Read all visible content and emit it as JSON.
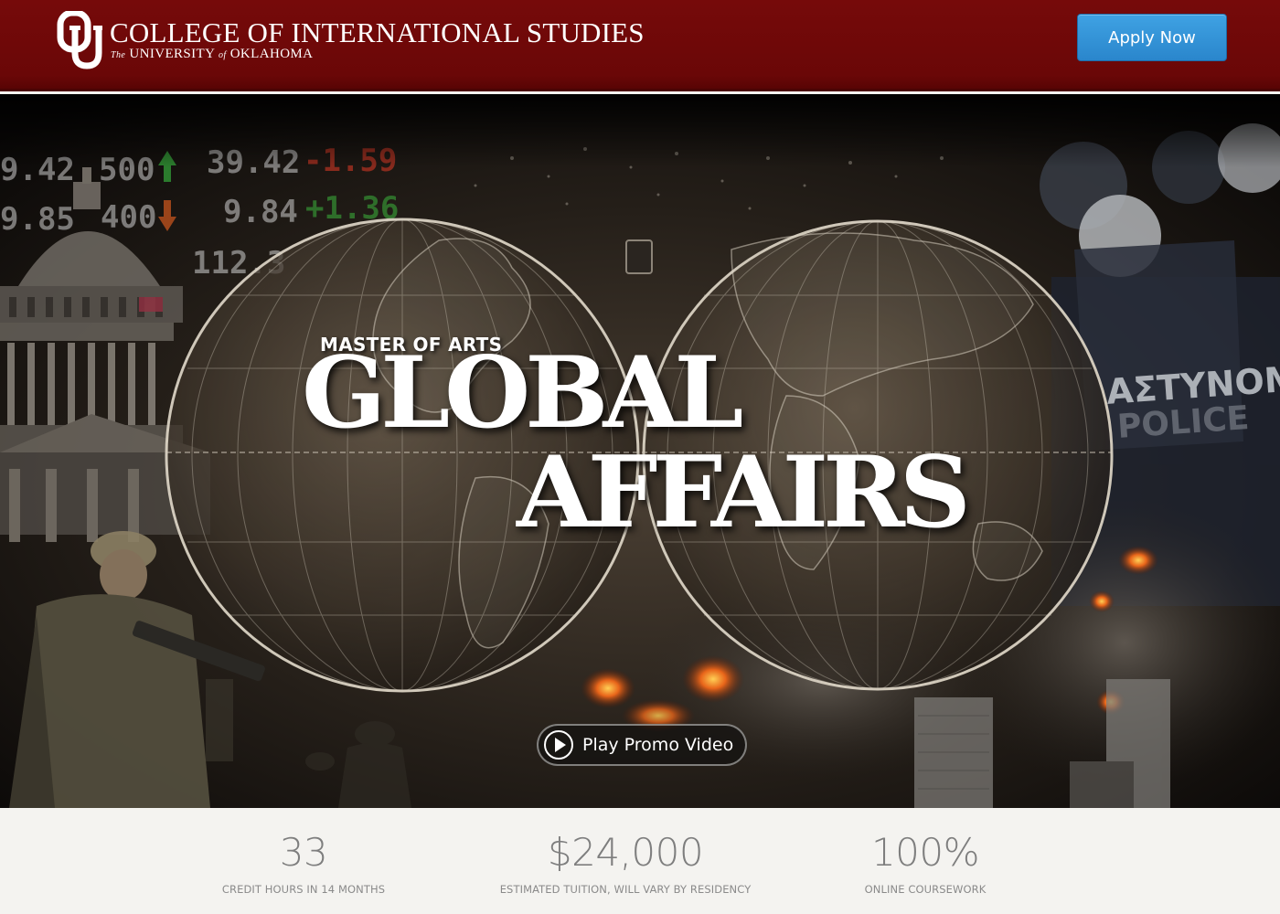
{
  "header": {
    "college_name": "COLLEGE OF INTERNATIONAL STUDIES",
    "university_prefix": "The",
    "university_word": "UNIVERSITY",
    "university_of": "of",
    "university_state": "OKLAHOMA",
    "apply_label": "Apply Now",
    "colors": {
      "background": "#6e0808",
      "apply_button": "#2f8fd6"
    }
  },
  "hero": {
    "degree_prefix": "MASTER OF ARTS",
    "title_line1": "GLOBAL",
    "title_line2": "AFFAIRS",
    "promo_label": "Play Promo Video",
    "promo_icon": "play-circle-icon",
    "background_text": {
      "ticker_1": "9.42",
      "ticker_2": "500",
      "ticker_3": "39.42",
      "ticker_4": "-1.59",
      "ticker_5": "9.85",
      "ticker_6": "400",
      "ticker_7": "9.84",
      "ticker_8": "+1.36",
      "ticker_9": "112.3",
      "shield_line1": "ΑΣΤΥΝΟΜΙΑ",
      "shield_line2": "POLICE"
    }
  },
  "stats": [
    {
      "value": "33",
      "label": "CREDIT HOURS IN 14 MONTHS"
    },
    {
      "value": "$24,000",
      "label": "ESTIMATED TUITION, WILL VARY BY RESIDENCY"
    },
    {
      "value": "100%",
      "label": "ONLINE COURSEWORK"
    }
  ]
}
